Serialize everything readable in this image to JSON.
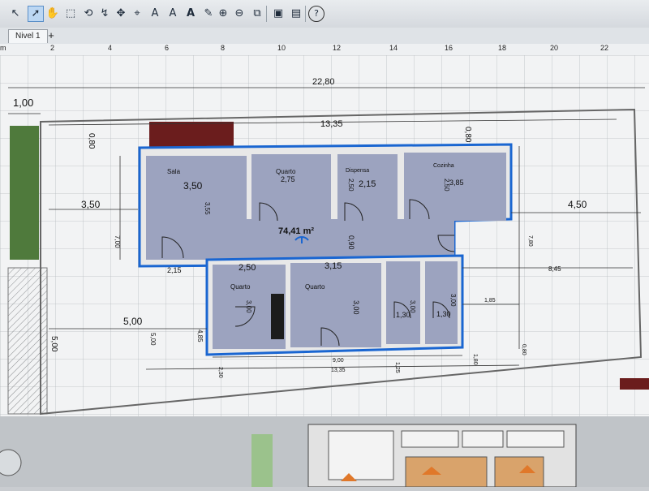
{
  "toolbar": {
    "icons": [
      "select-arrow-icon",
      "pointer-icon",
      "pan-hand-icon",
      "create-room-icon",
      "create-polyline-icon",
      "rotate-icon",
      "create-dimension-icon",
      "add-point-icon",
      "add-label-icon",
      "add-text-icon",
      "modify-text-icon",
      "zoom-in-icon",
      "zoom-out-icon",
      "import-furniture-icon",
      "photo-icon",
      "video-icon",
      "help-icon"
    ],
    "help_label": "?"
  },
  "tabs": {
    "level_label": "Nivel 1",
    "add_label": "+"
  },
  "ruler": {
    "unit": "m",
    "ticks": [
      "2",
      "4",
      "6",
      "8",
      "10",
      "12",
      "14",
      "16",
      "18",
      "20",
      "22"
    ]
  },
  "plan": {
    "area": "74,41 m²",
    "rooms": {
      "sala": "Sala",
      "quarto_top": "Quarto",
      "despensa": "Dispensa",
      "cozinha": "Cozinha",
      "quarto_left": "Quarto",
      "quarto_mid": "Quarto"
    },
    "dims": {
      "total_width": "22,80",
      "left_margin_top": "1,00",
      "lot_width": "13,35",
      "front_setback": "0,80",
      "side_setback_top": "0,80",
      "left_side": "3,50",
      "right_side": "4,50",
      "sala_w": "3,50",
      "sala_h": "3,55",
      "q1_w": "2,75",
      "q1_h": "2,50",
      "desp_w": "2,15",
      "desp_h": "2,50",
      "coz_h": "3,85",
      "hall": "0,90",
      "left_height": "7,00",
      "right_height": "7,80",
      "sala_bottom": "2,15",
      "q2_w": "2,50",
      "q3_w": "3,15",
      "q2_h": "3,00",
      "q3_h": "3,00",
      "bath_h": "3,00",
      "bath_h2": "3,00",
      "bath_w1": "1,30",
      "bath_w2": "1,30",
      "lower_right": "8,45",
      "right_small": "1,85",
      "left_lower": "5,00",
      "left_lower2": "5,00",
      "left_lower3": "5,00",
      "wing": "4,85",
      "bottom_w": "9,00",
      "bottom_total": "13,35",
      "bottom_small": "2,30",
      "bottom_mid": "1,25",
      "bottom_r": "1,80",
      "far_right": "0,80"
    }
  },
  "colors": {
    "wall_outline": "#1a66d1",
    "room_fill": "#9ca3bf",
    "wall_fill": "#e6e6e6"
  }
}
